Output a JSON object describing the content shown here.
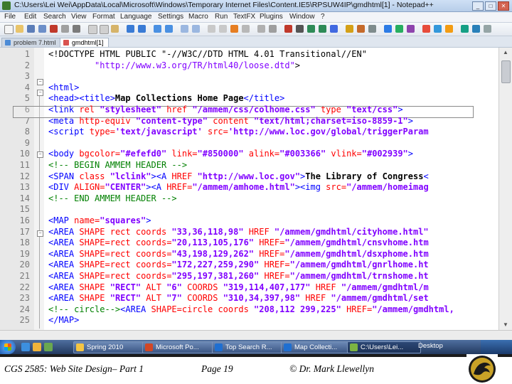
{
  "window": {
    "title": "C:\\Users\\Lei Wei\\AppData\\Local\\Microsoft\\Windows\\Temporary Internet Files\\Content.IE5\\RPSUW4IP\\gmdhtml[1] - Notepad++",
    "buttons": [
      "_",
      "□",
      "✕"
    ]
  },
  "menu": [
    "File",
    "Edit",
    "Search",
    "View",
    "Format",
    "Language",
    "Settings",
    "Macro",
    "Run",
    "TextFX",
    "Plugins",
    "Window",
    "?"
  ],
  "tabs": [
    {
      "label": "problem 7.html",
      "active": false
    },
    {
      "label": "gmdhtml[1]",
      "active": true
    }
  ],
  "editor": {
    "line_numbers": [
      "1",
      "2",
      "3",
      "4",
      "5",
      "6",
      "7",
      "8",
      "9",
      "10",
      "11",
      "12",
      "13",
      "14",
      "15",
      "16",
      "17",
      "18",
      "19",
      "20",
      "21",
      "22",
      "23",
      "24",
      "25"
    ]
  },
  "taskbar": {
    "items": [
      "Spring 2010",
      "Microsoft Po...",
      "Top Search R...",
      "Map Collecti...",
      "C:\\Users\\Lei..."
    ],
    "desktop": "Desktop"
  },
  "footer": {
    "course": "CGS 2585: Web Site Design– Part 1",
    "page": "Page 19",
    "author": "© Dr. Mark Llewellyn"
  }
}
